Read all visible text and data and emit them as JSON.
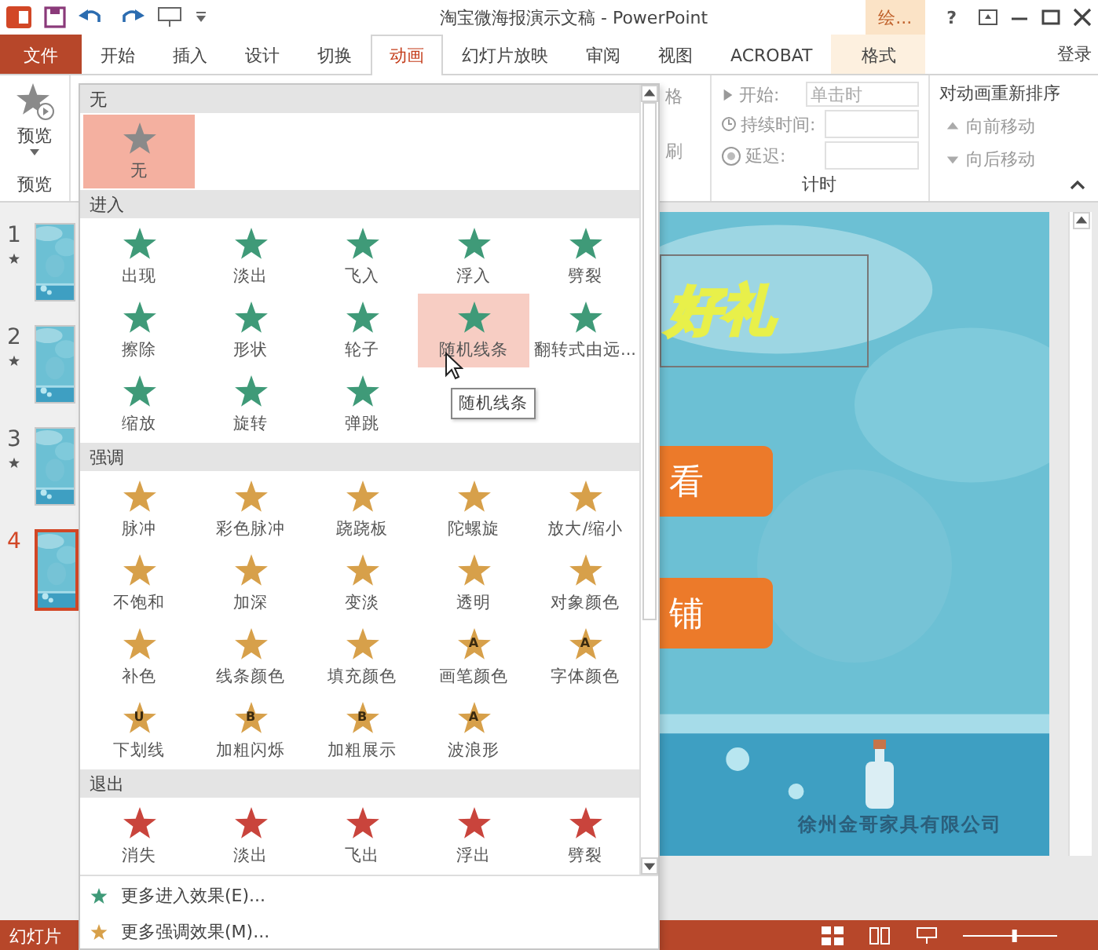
{
  "window": {
    "title": "淘宝微海报演示文稿 - PowerPoint",
    "context_tab": "绘...",
    "help": "?"
  },
  "tabs": [
    {
      "label": "文件",
      "kind": "file",
      "selected": false
    },
    {
      "label": "开始",
      "kind": "normal",
      "selected": false
    },
    {
      "label": "插入",
      "kind": "normal",
      "selected": false
    },
    {
      "label": "设计",
      "kind": "normal",
      "selected": false
    },
    {
      "label": "切换",
      "kind": "normal",
      "selected": false
    },
    {
      "label": "动画",
      "kind": "normal",
      "selected": true
    },
    {
      "label": "幻灯片放映",
      "kind": "normal",
      "selected": false
    },
    {
      "label": "审阅",
      "kind": "normal",
      "selected": false
    },
    {
      "label": "视图",
      "kind": "normal",
      "selected": false
    },
    {
      "label": "ACROBAT",
      "kind": "normal",
      "selected": false
    },
    {
      "label": "格式",
      "kind": "context",
      "selected": false
    }
  ],
  "account": "登录",
  "ribbon": {
    "preview": {
      "button": "预览",
      "group": "预览"
    },
    "partial_group": {
      "top": "格",
      "bottom": "刷"
    },
    "timing": {
      "start_label": "开始:",
      "start_value": "单击时",
      "duration_label": "持续时间:",
      "delay_label": "延迟:",
      "group": "计时"
    },
    "reorder": {
      "title": "对动画重新排序",
      "forward": "向前移动",
      "backward": "向后移动"
    }
  },
  "slides": [
    {
      "number": "1",
      "animated": true,
      "selected": false
    },
    {
      "number": "2",
      "animated": true,
      "selected": false
    },
    {
      "number": "3",
      "animated": true,
      "selected": false
    },
    {
      "number": "4",
      "animated": false,
      "selected": true
    }
  ],
  "slide": {
    "title": "好礼",
    "buttons": [
      "看",
      "铺"
    ],
    "company": "徐州金哥家具有限公司"
  },
  "gallery": {
    "sections": [
      {
        "title": "无",
        "kind": "none",
        "items": [
          {
            "label": "无",
            "selected": true,
            "hovered": false
          }
        ]
      },
      {
        "title": "进入",
        "kind": "entrance",
        "items": [
          {
            "label": "出现",
            "selected": false,
            "hovered": false
          },
          {
            "label": "淡出",
            "selected": false,
            "hovered": false
          },
          {
            "label": "飞入",
            "selected": false,
            "hovered": false
          },
          {
            "label": "浮入",
            "selected": false,
            "hovered": false
          },
          {
            "label": "劈裂",
            "selected": false,
            "hovered": false
          },
          {
            "label": "擦除",
            "selected": false,
            "hovered": false
          },
          {
            "label": "形状",
            "selected": false,
            "hovered": false
          },
          {
            "label": "轮子",
            "selected": false,
            "hovered": false
          },
          {
            "label": "随机线条",
            "selected": false,
            "hovered": true
          },
          {
            "label": "翻转式由远...",
            "selected": false,
            "hovered": false
          },
          {
            "label": "缩放",
            "selected": false,
            "hovered": false
          },
          {
            "label": "旋转",
            "selected": false,
            "hovered": false
          },
          {
            "label": "弹跳",
            "selected": false,
            "hovered": false
          }
        ]
      },
      {
        "title": "强调",
        "kind": "emphasis",
        "items": [
          {
            "label": "脉冲",
            "selected": false,
            "hovered": false
          },
          {
            "label": "彩色脉冲",
            "selected": false,
            "hovered": false
          },
          {
            "label": "跷跷板",
            "selected": false,
            "hovered": false
          },
          {
            "label": "陀螺旋",
            "selected": false,
            "hovered": false
          },
          {
            "label": "放大/缩小",
            "selected": false,
            "hovered": false
          },
          {
            "label": "不饱和",
            "selected": false,
            "hovered": false
          },
          {
            "label": "加深",
            "selected": false,
            "hovered": false
          },
          {
            "label": "变淡",
            "selected": false,
            "hovered": false
          },
          {
            "label": "透明",
            "selected": false,
            "hovered": false
          },
          {
            "label": "对象颜色",
            "selected": false,
            "hovered": false
          },
          {
            "label": "补色",
            "selected": false,
            "hovered": false
          },
          {
            "label": "线条颜色",
            "selected": false,
            "hovered": false
          },
          {
            "label": "填充颜色",
            "selected": false,
            "hovered": false
          },
          {
            "label": "画笔颜色",
            "glyph": "A",
            "selected": false,
            "hovered": false
          },
          {
            "label": "字体颜色",
            "glyph": "A",
            "selected": false,
            "hovered": false
          },
          {
            "label": "下划线",
            "glyph": "U",
            "selected": false,
            "hovered": false
          },
          {
            "label": "加粗闪烁",
            "glyph": "B",
            "selected": false,
            "hovered": false
          },
          {
            "label": "加粗展示",
            "glyph": "B",
            "selected": false,
            "hovered": false
          },
          {
            "label": "波浪形",
            "glyph": "A",
            "selected": false,
            "hovered": false
          }
        ]
      },
      {
        "title": "退出",
        "kind": "exit",
        "items": [
          {
            "label": "消失",
            "selected": false,
            "hovered": false
          },
          {
            "label": "淡出",
            "selected": false,
            "hovered": false
          },
          {
            "label": "飞出",
            "selected": false,
            "hovered": false
          },
          {
            "label": "浮出",
            "selected": false,
            "hovered": false
          },
          {
            "label": "劈裂",
            "selected": false,
            "hovered": false
          }
        ]
      }
    ],
    "tooltip": "随机线条",
    "links": [
      {
        "label": "更多进入效果(E)...",
        "kind": "entrance"
      },
      {
        "label": "更多强调效果(M)...",
        "kind": "emphasis"
      }
    ]
  },
  "status_bar": {
    "text": "幻灯片",
    "zoom": {
      "level": 0.55
    }
  }
}
